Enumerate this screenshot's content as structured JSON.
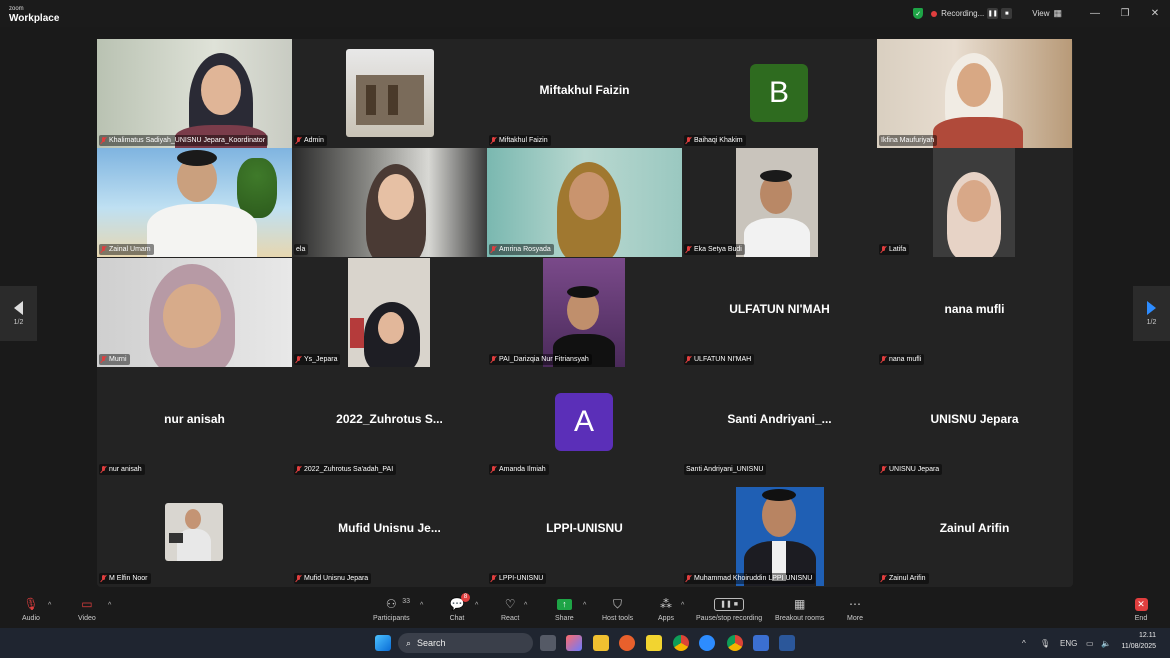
{
  "app": {
    "brand_small": "zoom",
    "brand_big": "Workplace"
  },
  "titlebar": {
    "recording_label": "Recording...",
    "view_label": "View",
    "pause_icon": "pause-icon",
    "stop_icon": "stop-icon"
  },
  "nav": {
    "page_left": "1/2",
    "page_right": "1/2"
  },
  "tiles": [
    {
      "name": "Khalimatus Sadiyah_UNISNU Jepara_Koordinator",
      "muted": true
    },
    {
      "name": "Admin",
      "muted": true
    },
    {
      "name": "Miftakhul Faizin",
      "display": "Miftakhul Faizin",
      "muted": true
    },
    {
      "name": "Baihaqi Khakim",
      "avatar": "B",
      "avatar_color": "#2e6b1f",
      "muted": true
    },
    {
      "name": "Ikfina Maufuriyah",
      "muted": false
    },
    {
      "name": "Zainal Umam",
      "muted": true
    },
    {
      "name": "ela",
      "muted": false
    },
    {
      "name": "Amrina Rosyada",
      "muted": true
    },
    {
      "name": "Eka Setya Budi",
      "muted": true
    },
    {
      "name": "Latifa",
      "muted": true
    },
    {
      "name": "Murni",
      "muted": true
    },
    {
      "name": "Ys_Jepara",
      "muted": true
    },
    {
      "name": "PAI_Darizqia Nur Fitriansyah",
      "muted": true
    },
    {
      "name": "ULFATUN NI'MAH",
      "display": "ULFATUN NI'MAH",
      "muted": true
    },
    {
      "name": "nana mufli",
      "display": "nana mufli",
      "muted": true
    },
    {
      "name": "nur anisah",
      "display": "nur anisah",
      "muted": true
    },
    {
      "name": "2022_Zuhrotus Sa'adah_PAI",
      "display": "2022_Zuhrotus  S...",
      "muted": true
    },
    {
      "name": "Amanda Ilmiah",
      "avatar": "A",
      "avatar_color": "#5b2fb8",
      "muted": true
    },
    {
      "name": "Santi Andriyani_UNISNU",
      "display": "Santi  Andriyani_...",
      "muted": false
    },
    {
      "name": "UNISNU Jepara",
      "display": "UNISNU Jepara",
      "muted": true
    },
    {
      "name": "M Elfin Noor",
      "muted": true
    },
    {
      "name": "Mufid Unisnu Jepara",
      "display": "Mufid  Unisnu  Je...",
      "muted": true
    },
    {
      "name": "LPPI-UNISNU",
      "display": "LPPI-UNISNU",
      "muted": false
    },
    {
      "name": "Muhammad Khoiruddin LPPI UNISNU",
      "muted": false
    },
    {
      "name": "Zainul Arifin",
      "display": "Zainul Arifin",
      "muted": true
    }
  ],
  "toolbar": {
    "audio": "Audio",
    "video": "Video",
    "participants": "Participants",
    "participants_count": "33",
    "chat": "Chat",
    "chat_badge": "8",
    "react": "React",
    "share": "Share",
    "host_tools": "Host tools",
    "apps": "Apps",
    "pause_recording": "Pause/stop recording",
    "breakout": "Breakout rooms",
    "more": "More",
    "end": "End"
  },
  "taskbar": {
    "search": "Search",
    "lang": "ENG",
    "time": "12.11",
    "date": "11/08/2025"
  }
}
